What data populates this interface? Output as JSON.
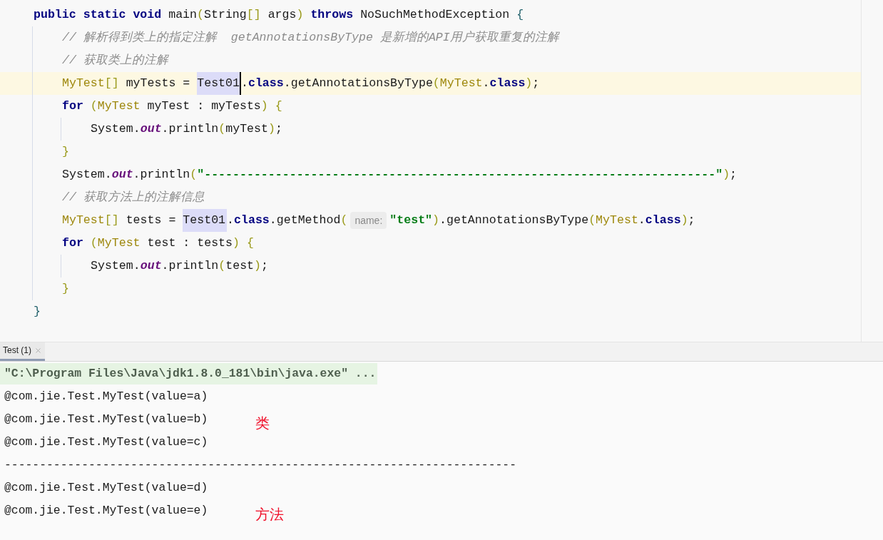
{
  "editor": {
    "lines": [
      {
        "current": false,
        "tokens": [
          {
            "kind": "kw",
            "t": "public static void"
          },
          {
            "kind": "plain",
            "t": " main"
          },
          {
            "kind": "br",
            "t": "("
          },
          {
            "kind": "plain",
            "t": "String"
          },
          {
            "kind": "br",
            "t": "[]"
          },
          {
            "kind": "plain",
            "t": " args"
          },
          {
            "kind": "br",
            "t": ")"
          },
          {
            "kind": "kw",
            "t": " throws"
          },
          {
            "kind": "plain",
            "t": " NoSuchMethodException "
          },
          {
            "kind": "brace",
            "t": "{"
          }
        ],
        "children": [
          {
            "current": false,
            "tokens": [
              {
                "kind": "comment",
                "t": "// 解析得到类上的指定注解  getAnnotationsByType 是新增的API用户获取重复的注解"
              }
            ]
          },
          {
            "current": false,
            "tokens": [
              {
                "kind": "comment",
                "t": "// 获取类上的注解"
              }
            ]
          },
          {
            "current": true,
            "tokens": [
              {
                "kind": "type",
                "t": "MyTest"
              },
              {
                "kind": "br",
                "t": "[]"
              },
              {
                "kind": "plain",
                "t": " myTests = "
              },
              {
                "kind": "ref",
                "t": "Test01",
                "caret": true
              },
              {
                "kind": "plain",
                "t": "."
              },
              {
                "kind": "kw",
                "t": "class"
              },
              {
                "kind": "plain",
                "t": ".getAnnotationsByType"
              },
              {
                "kind": "br",
                "t": "("
              },
              {
                "kind": "type",
                "t": "MyTest"
              },
              {
                "kind": "plain",
                "t": "."
              },
              {
                "kind": "kw",
                "t": "class"
              },
              {
                "kind": "br",
                "t": ")"
              },
              {
                "kind": "plain",
                "t": ";"
              }
            ]
          },
          {
            "current": false,
            "tokens": [
              {
                "kind": "kw",
                "t": "for"
              },
              {
                "kind": "br",
                "t": " ("
              },
              {
                "kind": "type",
                "t": "MyTest"
              },
              {
                "kind": "plain",
                "t": " myTest : myTests"
              },
              {
                "kind": "br",
                "t": ") {"
              }
            ],
            "children": [
              {
                "current": false,
                "tokens": [
                  {
                    "kind": "plain",
                    "t": "System."
                  },
                  {
                    "kind": "field",
                    "t": "out"
                  },
                  {
                    "kind": "plain",
                    "t": ".println"
                  },
                  {
                    "kind": "br",
                    "t": "("
                  },
                  {
                    "kind": "plain",
                    "t": "myTest"
                  },
                  {
                    "kind": "br",
                    "t": ")"
                  },
                  {
                    "kind": "plain",
                    "t": ";"
                  }
                ]
              }
            ]
          },
          {
            "current": false,
            "tokens": [
              {
                "kind": "br",
                "t": "}"
              }
            ]
          },
          {
            "current": false,
            "tokens": [
              {
                "kind": "plain",
                "t": "System."
              },
              {
                "kind": "field",
                "t": "out"
              },
              {
                "kind": "plain",
                "t": ".println"
              },
              {
                "kind": "br",
                "t": "("
              },
              {
                "kind": "str",
                "t": "\"------------------------------------------------------------------------\""
              },
              {
                "kind": "br",
                "t": ")"
              },
              {
                "kind": "plain",
                "t": ";"
              }
            ]
          },
          {
            "current": false,
            "tokens": [
              {
                "kind": "comment",
                "t": "// 获取方法上的注解信息"
              }
            ]
          },
          {
            "current": false,
            "tokens": [
              {
                "kind": "type",
                "t": "MyTest"
              },
              {
                "kind": "br",
                "t": "[]"
              },
              {
                "kind": "plain",
                "t": " tests = "
              },
              {
                "kind": "ref",
                "t": "Test01",
                "caret": false
              },
              {
                "kind": "plain",
                "t": "."
              },
              {
                "kind": "kw",
                "t": "class"
              },
              {
                "kind": "plain",
                "t": ".getMethod"
              },
              {
                "kind": "br",
                "t": "("
              },
              {
                "kind": "hint",
                "t": "name:"
              },
              {
                "kind": "str",
                "t": "\"test\""
              },
              {
                "kind": "br",
                "t": ")"
              },
              {
                "kind": "plain",
                "t": ".getAnnotationsByType"
              },
              {
                "kind": "br",
                "t": "("
              },
              {
                "kind": "type",
                "t": "MyTest"
              },
              {
                "kind": "plain",
                "t": "."
              },
              {
                "kind": "kw",
                "t": "class"
              },
              {
                "kind": "br",
                "t": ")"
              },
              {
                "kind": "plain",
                "t": ";"
              }
            ]
          },
          {
            "current": false,
            "tokens": [
              {
                "kind": "kw",
                "t": "for"
              },
              {
                "kind": "br",
                "t": " ("
              },
              {
                "kind": "type",
                "t": "MyTest"
              },
              {
                "kind": "plain",
                "t": " test : tests"
              },
              {
                "kind": "br",
                "t": ") {"
              }
            ],
            "children": [
              {
                "current": false,
                "tokens": [
                  {
                    "kind": "plain",
                    "t": "System."
                  },
                  {
                    "kind": "field",
                    "t": "out"
                  },
                  {
                    "kind": "plain",
                    "t": ".println"
                  },
                  {
                    "kind": "br",
                    "t": "("
                  },
                  {
                    "kind": "plain",
                    "t": "test"
                  },
                  {
                    "kind": "br",
                    "t": ")"
                  },
                  {
                    "kind": "plain",
                    "t": ";"
                  }
                ]
              }
            ]
          },
          {
            "current": false,
            "tokens": [
              {
                "kind": "br",
                "t": "}"
              }
            ]
          }
        ]
      },
      {
        "current": false,
        "tokens": [
          {
            "kind": "brace",
            "t": "}"
          }
        ]
      }
    ]
  },
  "run_panel": {
    "tabs": [
      {
        "label": "Test (1)",
        "selected": true
      }
    ],
    "lines": [
      {
        "kind": "command",
        "text": "\"C:\\Program Files\\Java\\jdk1.8.0_181\\bin\\java.exe\" ..."
      },
      {
        "kind": "output",
        "text": "@com.jie.Test.MyTest(value=a)"
      },
      {
        "kind": "output",
        "text": "@com.jie.Test.MyTest(value=b)",
        "note": "类"
      },
      {
        "kind": "output",
        "text": "@com.jie.Test.MyTest(value=c)"
      },
      {
        "kind": "output",
        "text": "-------------------------------------------------------------------------"
      },
      {
        "kind": "output",
        "text": "@com.jie.Test.MyTest(value=d)"
      },
      {
        "kind": "output",
        "text": "@com.jie.Test.MyTest(value=e)",
        "note": "方法"
      }
    ]
  }
}
